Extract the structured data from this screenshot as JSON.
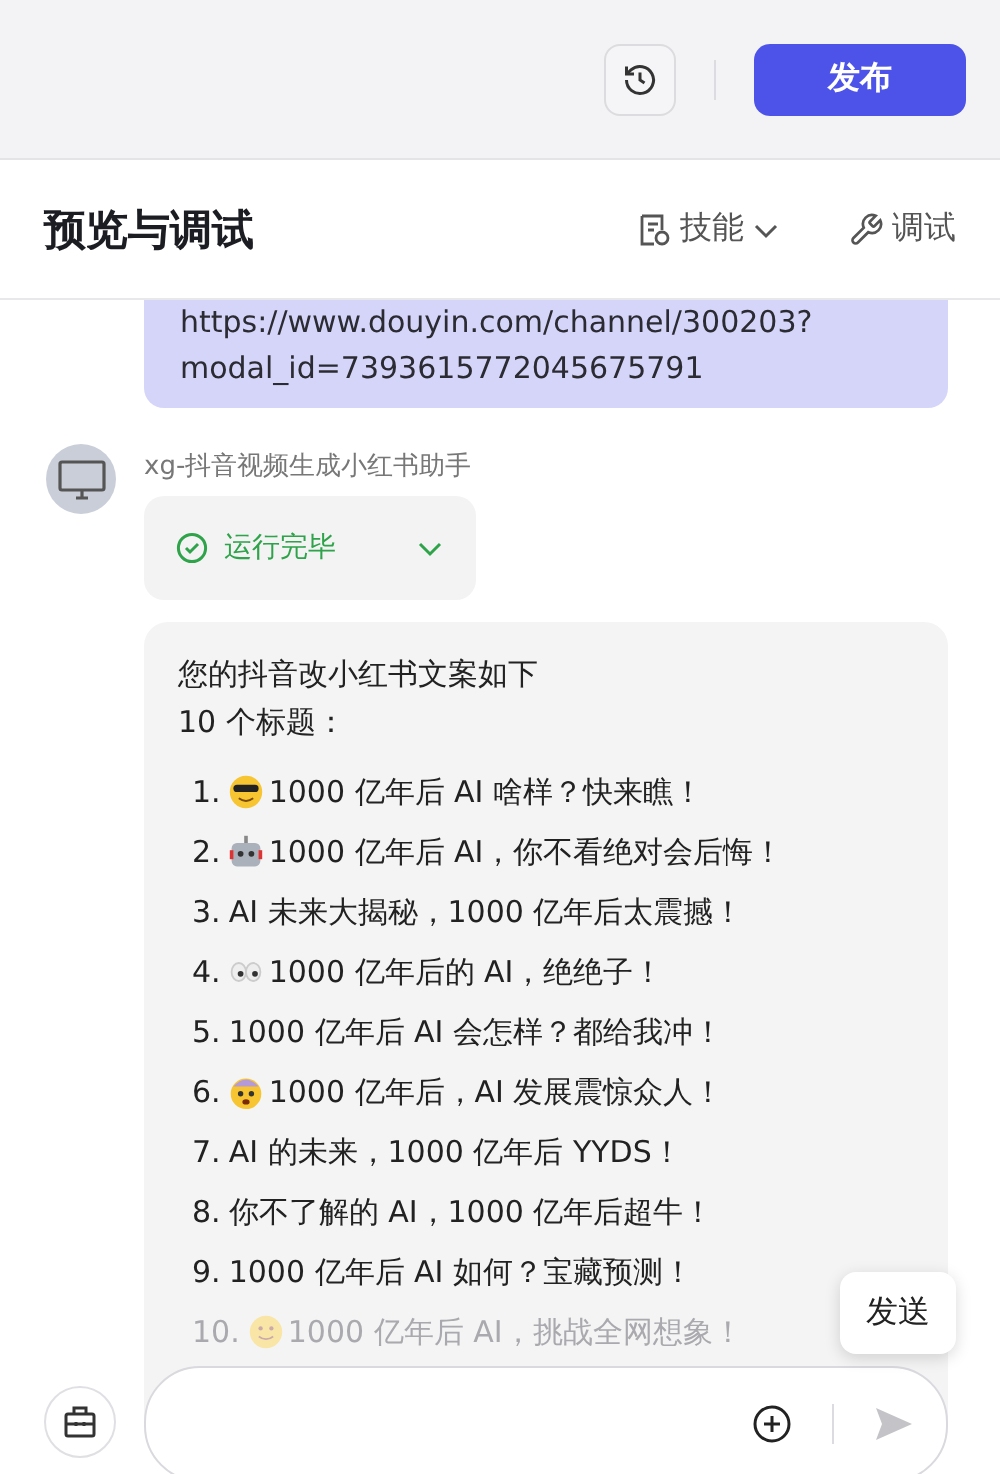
{
  "top_bar": {
    "publish_button": "发布"
  },
  "header": {
    "title": "预览与调试",
    "tools": [
      {
        "kind": "skills",
        "label": "技能"
      },
      {
        "kind": "debug",
        "label": "调试"
      }
    ]
  },
  "user_message": {
    "lines": [
      "https://www.douyin.com/channel/300203?",
      "modal_id=7393615772045675791"
    ]
  },
  "bot": {
    "name": "xg-抖音视频生成小红书助手",
    "status": "运行完毕",
    "intro": [
      "您的抖音改小红书文案如下",
      "10 个标题："
    ],
    "items": [
      {
        "number": "1.",
        "kind": "cool",
        "text": "1000 亿年后 AI 啥样？快来瞧！",
        "faded": false
      },
      {
        "number": "2.",
        "kind": "robot",
        "text": "1000 亿年后 AI，你不看绝对会后悔！",
        "faded": false
      },
      {
        "number": "3.",
        "kind": "plain",
        "text": "AI 未来大揭秘，1000 亿年后太震撼！",
        "faded": false
      },
      {
        "number": "4.",
        "kind": "eyes",
        "text": "1000 亿年后的 AI，绝绝子！",
        "faded": false
      },
      {
        "number": "5.",
        "kind": "plain",
        "text": "1000 亿年后 AI 会怎样？都给我冲！",
        "faded": false
      },
      {
        "number": "6.",
        "kind": "shock",
        "text": "1000 亿年后，AI 发展震惊众人！",
        "faded": false
      },
      {
        "number": "7.",
        "kind": "plain",
        "text": "AI 的未来，1000 亿年后 YYDS！",
        "faded": false
      },
      {
        "number": "8.",
        "kind": "plain",
        "text": "你不了解的 AI，1000 亿年后超牛！",
        "faded": false
      },
      {
        "number": "9.",
        "kind": "plain",
        "text": "1000 亿年后 AI 如何？宝藏预测！",
        "faded": false
      },
      {
        "number": "10.",
        "kind": "smile",
        "text": "1000 亿年后 AI，挑战全网想象！",
        "faded": true
      }
    ]
  },
  "tooltip": "发送"
}
